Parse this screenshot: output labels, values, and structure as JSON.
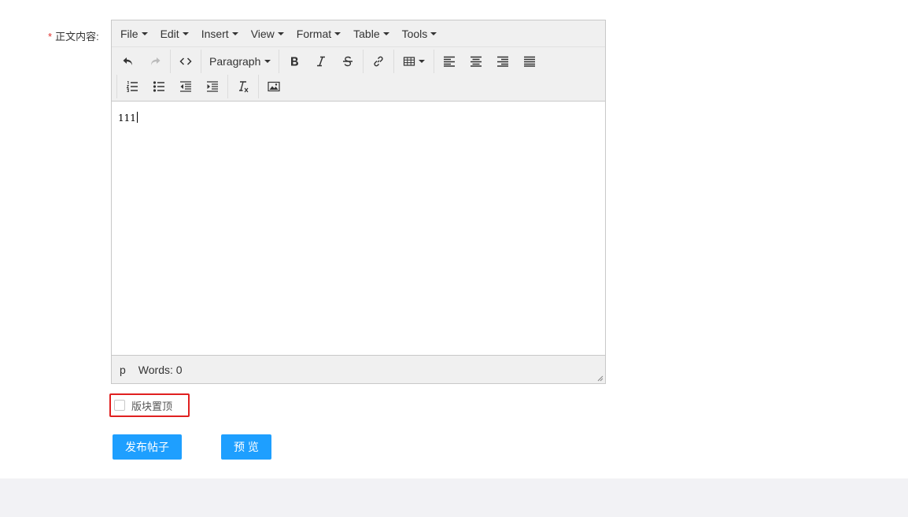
{
  "form": {
    "required_mark": "*",
    "label": "正文内容:"
  },
  "editor": {
    "menubar": [
      {
        "label": "File"
      },
      {
        "label": "Edit"
      },
      {
        "label": "Insert"
      },
      {
        "label": "View"
      },
      {
        "label": "Format"
      },
      {
        "label": "Table"
      },
      {
        "label": "Tools"
      }
    ],
    "toolbar": {
      "block_format": "Paragraph",
      "icons_row1": [
        "undo-icon",
        "redo-icon",
        "code-icon",
        "bold-icon",
        "italic-icon",
        "strikethrough-icon",
        "link-icon",
        "table-icon",
        "align-left-icon",
        "align-center-icon",
        "align-right-icon",
        "align-justify-icon"
      ],
      "icons_row2": [
        "numbered-list-icon",
        "bullet-list-icon",
        "outdent-icon",
        "indent-icon",
        "clear-formatting-icon",
        "image-icon"
      ]
    },
    "content": "111",
    "statusbar": {
      "path": "p",
      "words": "Words: 0"
    }
  },
  "pin_option": {
    "label": "版块置顶",
    "checked": false
  },
  "actions": {
    "publish_label": "发布帖子",
    "preview_label": "预 览"
  },
  "colors": {
    "primary": "#1e9fff",
    "required": "#e0302e",
    "highlight_border": "#e02020"
  }
}
